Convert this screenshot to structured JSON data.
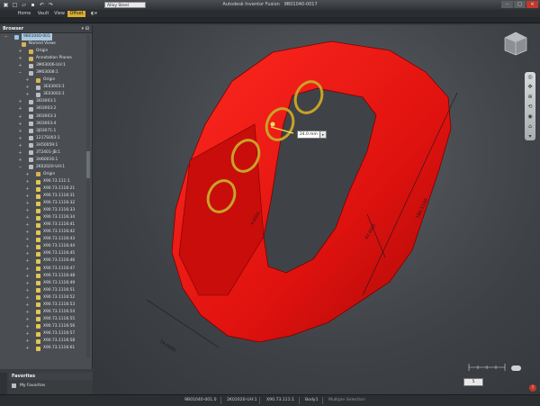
{
  "window": {
    "title": "Autodesk Inventor Fusion",
    "doc_label": "9B01040-0017",
    "controls": [
      "–",
      "□",
      "×"
    ]
  },
  "qat": {
    "icons": [
      "app-menu-icon",
      "new-icon",
      "open-icon",
      "save-icon",
      "undo-icon",
      "redo-icon"
    ]
  },
  "material_select": {
    "value": "Alloy Steel"
  },
  "tabs": [
    {
      "label": "Home"
    },
    {
      "label": "Vault"
    },
    {
      "label": "View"
    },
    {
      "label": "Offset",
      "active": true
    }
  ],
  "browser": {
    "title": "Browser",
    "controls": "▾ ⊡",
    "items": [
      {
        "label": "9B01040-001",
        "depth": 0,
        "icon": "root",
        "exp": "−",
        "selected": true
      },
      {
        "label": "Named Views",
        "depth": 1,
        "icon": "folder",
        "exp": ""
      },
      {
        "label": "Origin",
        "depth": 2,
        "icon": "origin",
        "exp": "+"
      },
      {
        "label": "Annotation Planes",
        "depth": 2,
        "icon": "folder",
        "exp": "+"
      },
      {
        "label": "3M03006-UH:1",
        "depth": 2,
        "icon": "part",
        "exp": "+"
      },
      {
        "label": "3M03008:1",
        "depth": 2,
        "icon": "part",
        "exp": "−"
      },
      {
        "label": "Origin",
        "depth": 3,
        "icon": "origin",
        "exp": "+"
      },
      {
        "label": "3E03003:1",
        "depth": 3,
        "icon": "part",
        "exp": "+"
      },
      {
        "label": "3E03003:1",
        "depth": 3,
        "icon": "part",
        "exp": "+"
      },
      {
        "label": "3I03003:1",
        "depth": 2,
        "icon": "part",
        "exp": "+"
      },
      {
        "label": "3I03003:2",
        "depth": 2,
        "icon": "part",
        "exp": "+"
      },
      {
        "label": "3I03003:3",
        "depth": 2,
        "icon": "part",
        "exp": "+"
      },
      {
        "label": "3I03003:4",
        "depth": 2,
        "icon": "part",
        "exp": "+"
      },
      {
        "label": "3J03071:1",
        "depth": 2,
        "icon": "part",
        "exp": "+"
      },
      {
        "label": "1217S003:1",
        "depth": 2,
        "icon": "part",
        "exp": "+"
      },
      {
        "label": "3H50059:1",
        "depth": 2,
        "icon": "part",
        "exp": "+"
      },
      {
        "label": "3T2401-JB:1",
        "depth": 2,
        "icon": "part",
        "exp": "+"
      },
      {
        "label": "3H60016:1",
        "depth": 2,
        "icon": "part",
        "exp": "+"
      },
      {
        "label": "2K02020-UH:1",
        "depth": 2,
        "icon": "part",
        "exp": "−"
      },
      {
        "label": "Origin",
        "depth": 3,
        "icon": "origin",
        "exp": "+"
      },
      {
        "label": "X90.73.111:1",
        "depth": 3,
        "icon": "warn",
        "exp": "+"
      },
      {
        "label": "X90.73.1116:21",
        "depth": 3,
        "icon": "warn",
        "exp": "+"
      },
      {
        "label": "X90.73.1116:31",
        "depth": 3,
        "icon": "warn",
        "exp": "+"
      },
      {
        "label": "X90.73.1116:32",
        "depth": 3,
        "icon": "warn",
        "exp": "+"
      },
      {
        "label": "X90.73.1116:33",
        "depth": 3,
        "icon": "warn",
        "exp": "+"
      },
      {
        "label": "X90.73.1116:34",
        "depth": 3,
        "icon": "warn",
        "exp": "+"
      },
      {
        "label": "X90.73.1116:41",
        "depth": 3,
        "icon": "warn",
        "exp": "+"
      },
      {
        "label": "X90.73.1116:42",
        "depth": 3,
        "icon": "warn",
        "exp": "+"
      },
      {
        "label": "X90.73.1116:43",
        "depth": 3,
        "icon": "warn",
        "exp": "+"
      },
      {
        "label": "X90.73.1116:44",
        "depth": 3,
        "icon": "warn",
        "exp": "+"
      },
      {
        "label": "X90.73.1116:45",
        "depth": 3,
        "icon": "warn",
        "exp": "+"
      },
      {
        "label": "X90.73.1116:46",
        "depth": 3,
        "icon": "warn",
        "exp": "+"
      },
      {
        "label": "X90.73.1116:47",
        "depth": 3,
        "icon": "warn",
        "exp": "+"
      },
      {
        "label": "X90.73.1116:48",
        "depth": 3,
        "icon": "warn",
        "exp": "+"
      },
      {
        "label": "X90.73.1116:49",
        "depth": 3,
        "icon": "warn",
        "exp": "+"
      },
      {
        "label": "X90.73.1116:51",
        "depth": 3,
        "icon": "warn",
        "exp": "+"
      },
      {
        "label": "X90.73.1116:52",
        "depth": 3,
        "icon": "warn",
        "exp": "+"
      },
      {
        "label": "X90.73.1116:53",
        "depth": 3,
        "icon": "warn",
        "exp": "+"
      },
      {
        "label": "X90.73.1116:54",
        "depth": 3,
        "icon": "warn",
        "exp": "+"
      },
      {
        "label": "X90.73.1116:55",
        "depth": 3,
        "icon": "warn",
        "exp": "+"
      },
      {
        "label": "X90.73.1116:56",
        "depth": 3,
        "icon": "warn",
        "exp": "+"
      },
      {
        "label": "X90.73.1116:57",
        "depth": 3,
        "icon": "warn",
        "exp": "+"
      },
      {
        "label": "X90.73.1116:58",
        "depth": 3,
        "icon": "warn",
        "exp": "+"
      },
      {
        "label": "X90.73.1116:61",
        "depth": 3,
        "icon": "warn",
        "exp": "+"
      }
    ]
  },
  "favorites": {
    "title": "Favorites",
    "item": "My Favorites"
  },
  "viewport": {
    "model_color": "#e0120f",
    "edge_color": "#7a0000",
    "ring_color": "#c9a227",
    "dim_input": "24.0 mm",
    "dim_labels": [
      "24.0000",
      "180.5100",
      "6.0000",
      "43.0000"
    ],
    "scale_value": "5"
  },
  "status": {
    "items": [
      "9B01040-001.0",
      "2K02020-UH:1",
      "X90.73.111:1",
      "Body1",
      "Multiple Selection"
    ]
  }
}
